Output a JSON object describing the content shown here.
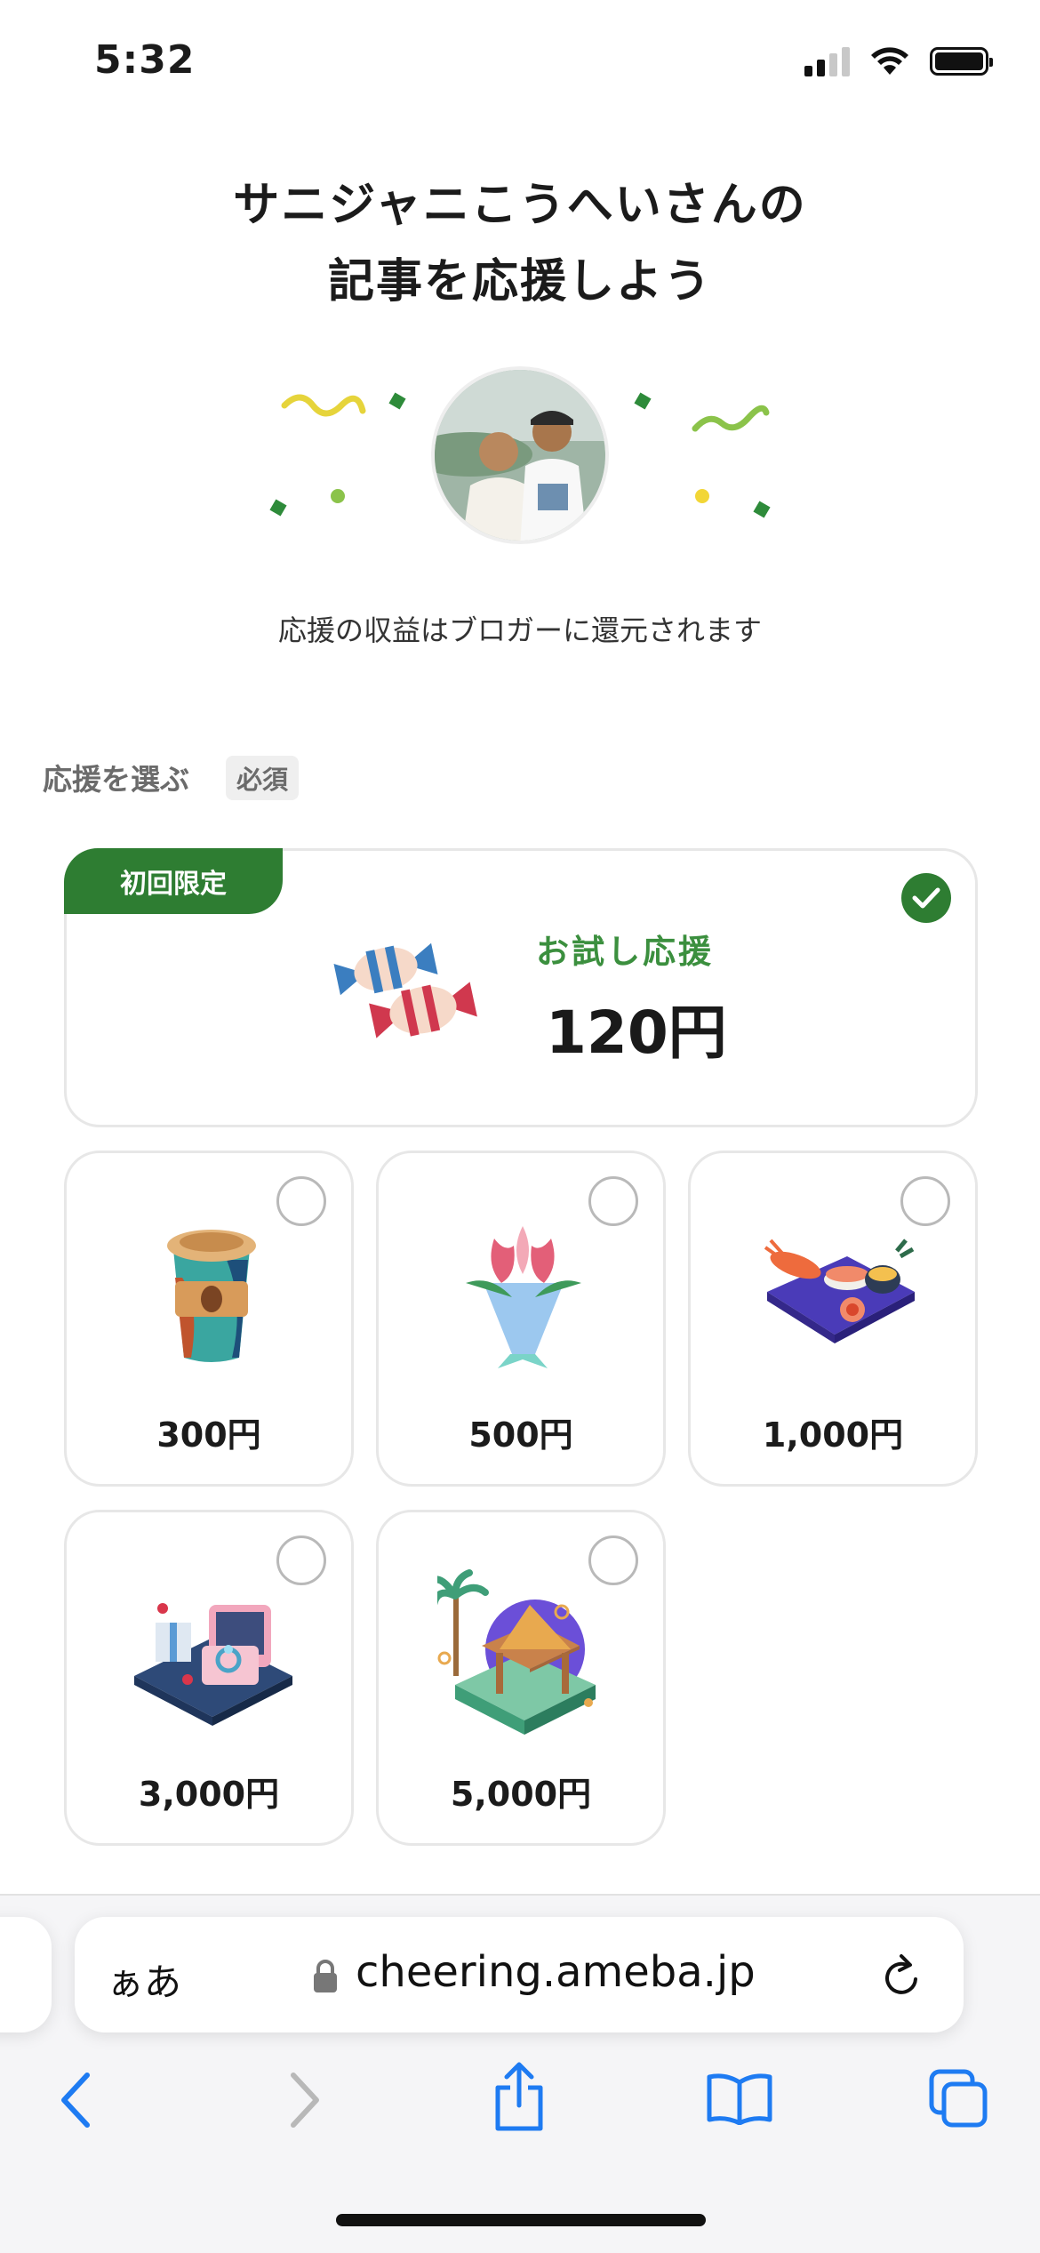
{
  "status_bar": {
    "time": "5:32"
  },
  "header": {
    "title_line1": "サニジャニこうへいさんの",
    "title_line2": "記事を応援しよう",
    "subtitle": "応援の収益はブロガーに還元されます"
  },
  "selection": {
    "label": "応援を選ぶ",
    "required_badge": "必須"
  },
  "trial_option": {
    "ribbon": "初回限定",
    "name": "お試し応援",
    "price": "120円",
    "selected": true,
    "icon": "candy-icon"
  },
  "options": [
    {
      "price": "300円",
      "icon": "coffee-cup-icon",
      "selected": false
    },
    {
      "price": "500円",
      "icon": "flower-bouquet-icon",
      "selected": false
    },
    {
      "price": "1,000円",
      "icon": "sushi-platter-icon",
      "selected": false
    },
    {
      "price": "3,000円",
      "icon": "ring-box-icon",
      "selected": false
    },
    {
      "price": "5,000円",
      "icon": "resort-villa-icon",
      "selected": false
    }
  ],
  "browser": {
    "aa_label": "ぁあ",
    "url": "cheering.ameba.jp"
  },
  "colors": {
    "accent_green": "#2e7d32",
    "link_blue": "#1e7bf2"
  }
}
